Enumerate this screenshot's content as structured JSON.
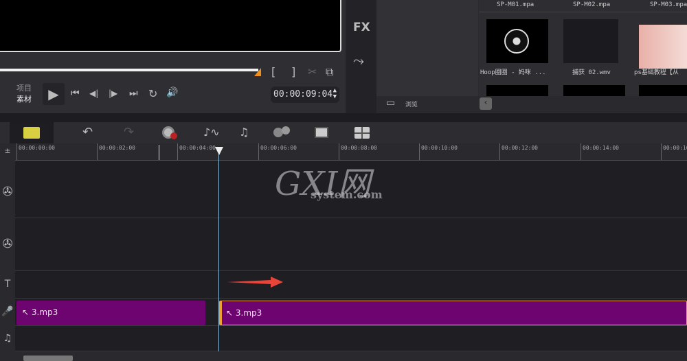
{
  "preview": {
    "mode_project": "项目",
    "mode_clip": "素材",
    "timecode": "00:00:09:04",
    "scrub_progress": 0.9,
    "buttons": {
      "play": "▶",
      "start": "⏮",
      "prev_frame": "◀|",
      "next_frame": "|▶",
      "end": "⏭",
      "repeat": "↻",
      "volume": "🔊",
      "mark_in": "[",
      "mark_out": "]",
      "cut": "✂",
      "copy": "⧉"
    }
  },
  "sidebar": {
    "fx": "FX",
    "path": "⤳"
  },
  "library": {
    "browse": "浏览",
    "items": [
      {
        "label": "SP-M01.mpa"
      },
      {
        "label": "SP-M02.mpa"
      },
      {
        "label": "SP-M03.mpa"
      },
      {
        "label": "Hoop圈圈 - 妈咪 ..."
      },
      {
        "label": "捕获 02.wmv"
      },
      {
        "label": "ps基础教程【从"
      }
    ]
  },
  "toolbar": {
    "icons": [
      "storyboard-icon",
      "undo-icon",
      "redo-icon",
      "record-capture-icon",
      "sound-mixer-icon",
      "auto-music-icon",
      "motion-icon",
      "subtitle-icon",
      "multi-camera-icon"
    ]
  },
  "ruler": {
    "ticks": [
      "00:00:00:00",
      "00:00:02:00",
      "00:00:04:00",
      "00:00:06:00",
      "00:00:08:00",
      "00:00:10:00",
      "00:00:12:00",
      "00:00:14:00",
      "00:00:16"
    ]
  },
  "timeline": {
    "clips": [
      {
        "label": "3.mp3"
      },
      {
        "label": "3.mp3"
      }
    ],
    "accent": "#6e0470"
  },
  "watermark": {
    "logo": "GXI网",
    "site": "system.com"
  }
}
